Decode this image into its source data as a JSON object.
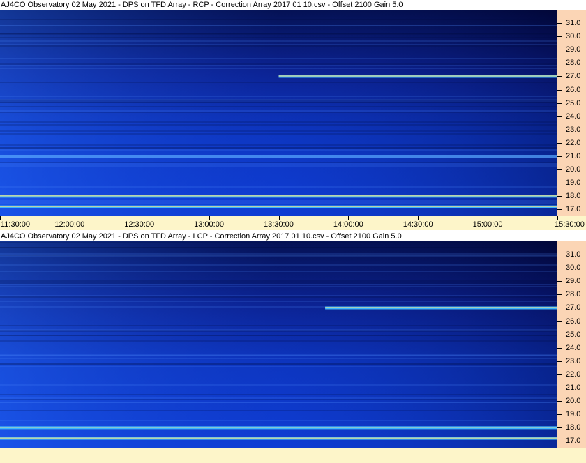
{
  "panels": [
    {
      "title": "AJ4CO Observatory 02 May 2021  -  DPS on TFD Array  -  RCP  -  Correction Array 2017 01 10.csv  -  Offset 2100  Gain 5.0"
    },
    {
      "title": "AJ4CO Observatory 02 May 2021  -  DPS on TFD Array  -  LCP  -  Correction Array 2017 01 10.csv  -  Offset 2100  Gain 5.0"
    }
  ],
  "colors": {
    "low": "#020a40",
    "mid": "#0e3dd6",
    "high": "#3fb8ff",
    "axis_bg": "#fbd5b5",
    "time_bg": "#fdf5c9"
  },
  "chart_data": [
    {
      "type": "heatmap",
      "title": "AJ4CO Observatory 02 May 2021  -  DPS on TFD Array  -  RCP  -  Correction Array 2017 01 10.csv  -  Offset 2100  Gain 5.0",
      "x_ticks": [
        "11:30:00",
        "12:00:00",
        "12:30:00",
        "13:00:00",
        "13:30:00",
        "14:00:00",
        "14:30:00",
        "15:00:00",
        "15:30:00"
      ],
      "y_ticks": [
        "31.0",
        "30.0",
        "29.0",
        "28.0",
        "27.0",
        "26.0",
        "25.0",
        "24.0",
        "23.0",
        "22.0",
        "21.0",
        "20.0",
        "19.0",
        "18.0",
        "17.0"
      ],
      "x_range": [
        "11:30:00",
        "15:30:00"
      ],
      "y_range": [
        16.5,
        32.0
      ],
      "features": [
        {
          "freq": 27.0,
          "start": "13:30:00",
          "end": "15:30:00",
          "intensity": "high"
        },
        {
          "freq": 18.0,
          "start": "11:30:00",
          "end": "15:30:00",
          "intensity": "high"
        },
        {
          "freq": 17.2,
          "start": "11:30:00",
          "end": "15:30:00",
          "intensity": "high"
        },
        {
          "freq": 21.0,
          "start": "11:30:00",
          "end": "15:30:00",
          "intensity": "medium"
        }
      ]
    },
    {
      "type": "heatmap",
      "title": "AJ4CO Observatory 02 May 2021  -  DPS on TFD Array  -  LCP  -  Correction Array 2017 01 10.csv  -  Offset 2100  Gain 5.0",
      "y_ticks": [
        "31.0",
        "30.0",
        "29.0",
        "28.0",
        "27.0",
        "26.0",
        "25.0",
        "24.0",
        "23.0",
        "22.0",
        "21.0",
        "20.0",
        "19.0",
        "18.0",
        "17.0"
      ],
      "x_range": [
        "11:30:00",
        "15:30:00"
      ],
      "y_range": [
        16.5,
        32.0
      ],
      "features": [
        {
          "freq": 27.0,
          "start": "13:50:00",
          "end": "15:30:00",
          "intensity": "high"
        },
        {
          "freq": 18.0,
          "start": "11:30:00",
          "end": "15:30:00",
          "intensity": "high"
        },
        {
          "freq": 17.2,
          "start": "11:30:00",
          "end": "15:30:00",
          "intensity": "high"
        }
      ]
    }
  ]
}
